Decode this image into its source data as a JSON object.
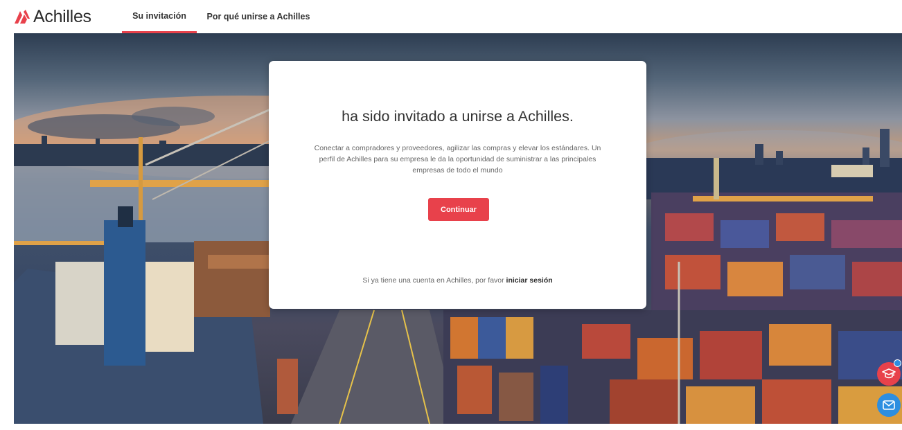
{
  "brand": {
    "name": "Achilles",
    "accent_color": "#e8414b"
  },
  "nav": {
    "tabs": [
      {
        "label": "Su invitación",
        "active": true
      },
      {
        "label": "Por qué unirse a Achilles",
        "active": false
      }
    ]
  },
  "card": {
    "title": "ha sido invitado a unirse a Achilles.",
    "description": "Conectar a compradores y proveedores, agilizar las compras y elevar los estándares. Un perfil de Achilles para su empresa le da la oportunidad de suministrar a las principales empresas de todo el mundo",
    "continue_label": "Continuar",
    "login_prefix": "Si ya tiene una cuenta en Achilles, por favor",
    "login_link": "iniciar sesión"
  },
  "floating": {
    "academy_icon": "graduation-cap-icon",
    "mail_icon": "envelope-icon",
    "academy_color": "#e8414b",
    "mail_color": "#2d8ee0"
  }
}
